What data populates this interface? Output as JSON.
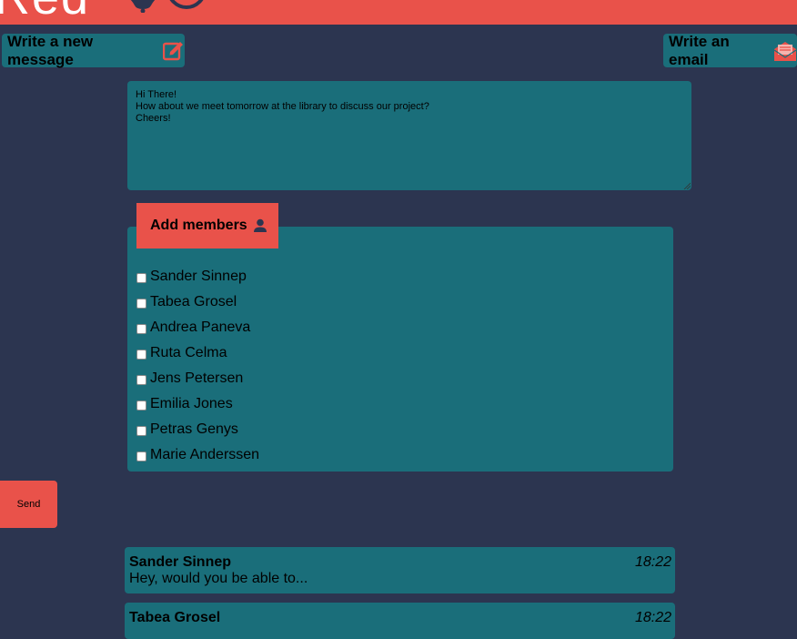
{
  "header": {
    "logo_text": "Red",
    "icons": [
      "bell-icon",
      "avatar-icon"
    ],
    "accent_color": "#e9524a"
  },
  "toolbar": {
    "write_message_label": "Write a new message",
    "write_email_label": "Write an email"
  },
  "composer": {
    "lines": [
      "Hi There!",
      "How about we meet tomorrow at the library to discuss our project?",
      "Cheers!"
    ]
  },
  "members": {
    "add_label": "Add members",
    "items": [
      {
        "name": "Sander Sinnep",
        "checked": false
      },
      {
        "name": "Tabea Grosel",
        "checked": false
      },
      {
        "name": "Andrea Paneva",
        "checked": false
      },
      {
        "name": "Ruta Celma",
        "checked": false
      },
      {
        "name": "Jens Petersen",
        "checked": false
      },
      {
        "name": "Emilia Jones",
        "checked": false
      },
      {
        "name": "Petras Genys",
        "checked": false
      },
      {
        "name": "Marie Anderssen",
        "checked": false
      }
    ]
  },
  "send_label": "Send",
  "chats": [
    {
      "name": "Sander Sinnep",
      "time": "18:22",
      "preview": "Hey, would you be able to..."
    },
    {
      "name": "Tabea Grosel",
      "time": "18:22",
      "preview": ""
    }
  ],
  "colors": {
    "background": "#2c3550",
    "panel": "#1a6e7a",
    "accent": "#e9524a"
  }
}
